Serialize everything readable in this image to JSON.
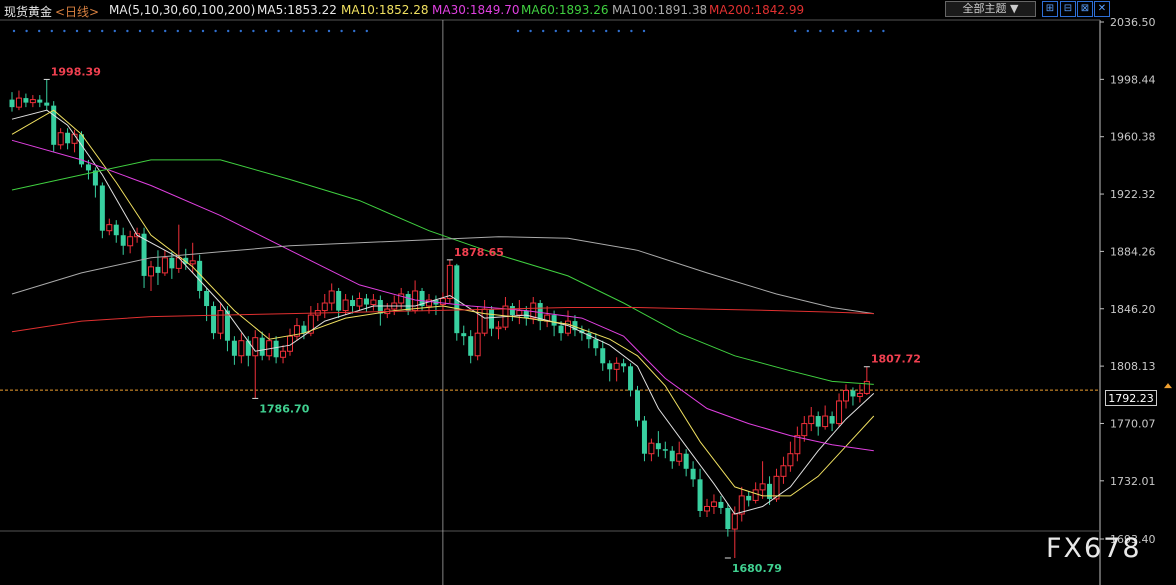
{
  "header": {
    "instrument": "现货黄金",
    "period": "<日线>",
    "ma_params": "MA(5,10,30,60,100,200)",
    "ma5": "MA5:1853.22",
    "ma10": "MA10:1852.28",
    "ma30": "MA30:1849.70",
    "ma60": "MA60:1893.26",
    "ma100": "MA100:1891.38",
    "ma200": "MA200:1842.99",
    "theme_label": "全部主题",
    "buttons": [
      "⊞",
      "⊟",
      "⊠",
      "✕"
    ]
  },
  "colors": {
    "up": "#f0303a",
    "down": "#38d0a0",
    "ma5": "#e0e0e0",
    "ma10": "#f0e060",
    "ma30": "#e040e0",
    "ma60": "#40d040",
    "ma100": "#aaaaaa",
    "ma200": "#e03030",
    "price_line": "#f0a030"
  },
  "watermark": "FX678",
  "current_price": "1792.23",
  "chart_data": {
    "type": "candlestick",
    "yticks": [
      2036.5,
      1998.44,
      1960.38,
      1922.32,
      1884.26,
      1846.2,
      1808.13,
      1770.07,
      1732.01,
      1693.4
    ],
    "ytick_labels": [
      "2036.50",
      "1998.44",
      "1960.38",
      "1922.32",
      "1884.26",
      "1846.20",
      "1808.13",
      "1770.07",
      "1732.01",
      "1693.40"
    ],
    "annotations": [
      {
        "text": "1998.39",
        "index": 5,
        "value": 1998.39,
        "type": "high"
      },
      {
        "text": "1786.70",
        "index": 35,
        "value": 1786.7,
        "type": "low"
      },
      {
        "text": "1878.65",
        "index": 63,
        "value": 1878.65,
        "type": "high"
      },
      {
        "text": "1680.79",
        "index": 103,
        "value": 1680.79,
        "type": "low"
      },
      {
        "text": "1807.72",
        "index": 123,
        "value": 1807.72,
        "type": "high"
      }
    ],
    "candles": [
      [
        1985,
        1980,
        1990,
        1977
      ],
      [
        1980,
        1986,
        1991,
        1978
      ],
      [
        1986,
        1983,
        1989,
        1980
      ],
      [
        1983,
        1985,
        1988,
        1980
      ],
      [
        1985,
        1983,
        1988,
        1980
      ],
      [
        1983,
        1981,
        1998.39,
        1978
      ],
      [
        1981,
        1955,
        1984,
        1950
      ],
      [
        1955,
        1963,
        1966,
        1952
      ],
      [
        1963,
        1956,
        1966,
        1952
      ],
      [
        1956,
        1962,
        1965,
        1950
      ],
      [
        1962,
        1942,
        1964,
        1940
      ],
      [
        1942,
        1938,
        1945,
        1932
      ],
      [
        1938,
        1928,
        1940,
        1920
      ],
      [
        1928,
        1898,
        1930,
        1893
      ],
      [
        1898,
        1902,
        1906,
        1895
      ],
      [
        1902,
        1895,
        1905,
        1890
      ],
      [
        1895,
        1888,
        1900,
        1882
      ],
      [
        1888,
        1894,
        1898,
        1883
      ],
      [
        1894,
        1896,
        1900,
        1890
      ],
      [
        1896,
        1868,
        1900,
        1860
      ],
      [
        1868,
        1874,
        1878,
        1858
      ],
      [
        1874,
        1870,
        1885,
        1862
      ],
      [
        1870,
        1880,
        1885,
        1868
      ],
      [
        1880,
        1873,
        1884,
        1866
      ],
      [
        1873,
        1880,
        1902,
        1870
      ],
      [
        1880,
        1876,
        1886,
        1872
      ],
      [
        1876,
        1878,
        1890,
        1870
      ],
      [
        1878,
        1858,
        1882,
        1853
      ],
      [
        1858,
        1848,
        1860,
        1838
      ],
      [
        1848,
        1830,
        1851,
        1826
      ],
      [
        1830,
        1845,
        1850,
        1826
      ],
      [
        1845,
        1825,
        1848,
        1818
      ],
      [
        1825,
        1815,
        1828,
        1809
      ],
      [
        1815,
        1825,
        1830,
        1810
      ],
      [
        1825,
        1815,
        1828,
        1808
      ],
      [
        1815,
        1827,
        1832,
        1786.7
      ],
      [
        1827,
        1815,
        1831,
        1812
      ],
      [
        1815,
        1825,
        1830,
        1812
      ],
      [
        1825,
        1814,
        1828,
        1810
      ],
      [
        1814,
        1818,
        1822,
        1810
      ],
      [
        1818,
        1828,
        1833,
        1815
      ],
      [
        1828,
        1835,
        1840,
        1825
      ],
      [
        1835,
        1830,
        1838,
        1826
      ],
      [
        1830,
        1842,
        1848,
        1828
      ],
      [
        1842,
        1845,
        1850,
        1838
      ],
      [
        1845,
        1850,
        1856,
        1840
      ],
      [
        1850,
        1858,
        1863,
        1845
      ],
      [
        1858,
        1845,
        1860,
        1840
      ],
      [
        1845,
        1852,
        1856,
        1842
      ],
      [
        1852,
        1848,
        1855,
        1843
      ],
      [
        1848,
        1853,
        1857,
        1845
      ],
      [
        1853,
        1849,
        1856,
        1844
      ],
      [
        1849,
        1852,
        1856,
        1845
      ],
      [
        1852,
        1843,
        1855,
        1835
      ],
      [
        1843,
        1846,
        1850,
        1840
      ],
      [
        1846,
        1850,
        1855,
        1842
      ],
      [
        1850,
        1856,
        1860,
        1846
      ],
      [
        1856,
        1845,
        1858,
        1842
      ],
      [
        1845,
        1858,
        1865,
        1843
      ],
      [
        1858,
        1848,
        1860,
        1845
      ],
      [
        1848,
        1852,
        1856,
        1843
      ],
      [
        1852,
        1849,
        1855,
        1842
      ],
      [
        1849,
        1853,
        1857,
        1845
      ],
      [
        1853,
        1875,
        1878.65,
        1850
      ],
      [
        1875,
        1830,
        1876,
        1825
      ],
      [
        1830,
        1828,
        1835,
        1822
      ],
      [
        1828,
        1815,
        1832,
        1810
      ],
      [
        1815,
        1830,
        1848,
        1812
      ],
      [
        1830,
        1846,
        1852,
        1828
      ],
      [
        1846,
        1833,
        1848,
        1828
      ],
      [
        1833,
        1834,
        1838,
        1826
      ],
      [
        1834,
        1848,
        1854,
        1832
      ],
      [
        1848,
        1842,
        1850,
        1838
      ],
      [
        1842,
        1845,
        1852,
        1836
      ],
      [
        1845,
        1840,
        1848,
        1835
      ],
      [
        1840,
        1850,
        1854,
        1836
      ],
      [
        1850,
        1838,
        1852,
        1832
      ],
      [
        1838,
        1842,
        1848,
        1834
      ],
      [
        1842,
        1835,
        1845,
        1828
      ],
      [
        1835,
        1830,
        1838,
        1825
      ],
      [
        1830,
        1838,
        1845,
        1828
      ],
      [
        1838,
        1832,
        1842,
        1828
      ],
      [
        1832,
        1830,
        1835,
        1825
      ],
      [
        1830,
        1826,
        1833,
        1820
      ],
      [
        1826,
        1820,
        1830,
        1815
      ],
      [
        1820,
        1810,
        1825,
        1805
      ],
      [
        1810,
        1806,
        1812,
        1798
      ],
      [
        1806,
        1810,
        1814,
        1798
      ],
      [
        1810,
        1808,
        1813,
        1804
      ],
      [
        1808,
        1792,
        1810,
        1788
      ],
      [
        1792,
        1772,
        1795,
        1768
      ],
      [
        1772,
        1750,
        1775,
        1745
      ],
      [
        1750,
        1757,
        1760,
        1745
      ],
      [
        1757,
        1753,
        1765,
        1748
      ],
      [
        1753,
        1752,
        1758,
        1747
      ],
      [
        1752,
        1745,
        1755,
        1740
      ],
      [
        1745,
        1750,
        1758,
        1742
      ],
      [
        1750,
        1740,
        1753,
        1735
      ],
      [
        1740,
        1733,
        1745,
        1728
      ],
      [
        1733,
        1712,
        1740,
        1708
      ],
      [
        1712,
        1715,
        1720,
        1708
      ],
      [
        1715,
        1718,
        1723,
        1710
      ],
      [
        1718,
        1714,
        1722,
        1710
      ],
      [
        1714,
        1700,
        1717,
        1695
      ],
      [
        1700,
        1710,
        1715,
        1680.79
      ],
      [
        1710,
        1722,
        1728,
        1705
      ],
      [
        1722,
        1719,
        1725,
        1715
      ],
      [
        1719,
        1726,
        1731,
        1717
      ],
      [
        1726,
        1730,
        1745,
        1720
      ],
      [
        1730,
        1720,
        1735,
        1716
      ],
      [
        1720,
        1735,
        1740,
        1718
      ],
      [
        1735,
        1742,
        1748,
        1730
      ],
      [
        1742,
        1750,
        1758,
        1738
      ],
      [
        1750,
        1762,
        1768,
        1745
      ],
      [
        1762,
        1770,
        1775,
        1758
      ],
      [
        1770,
        1775,
        1781,
        1765
      ],
      [
        1775,
        1768,
        1778,
        1762
      ],
      [
        1768,
        1775,
        1782,
        1766
      ],
      [
        1775,
        1770,
        1778,
        1765
      ],
      [
        1770,
        1785,
        1790,
        1768
      ],
      [
        1785,
        1792,
        1796,
        1780
      ],
      [
        1792,
        1788,
        1794,
        1782
      ],
      [
        1788,
        1790,
        1796,
        1784
      ],
      [
        1790,
        1798,
        1807.72,
        1789
      ]
    ],
    "ma": [
      {
        "name": "MA5",
        "color_key": "ma5",
        "points": [
          [
            0,
            1972
          ],
          [
            5,
            1978
          ],
          [
            8,
            1968
          ],
          [
            13,
            1935
          ],
          [
            18,
            1895
          ],
          [
            24,
            1880
          ],
          [
            30,
            1850
          ],
          [
            35,
            1818
          ],
          [
            40,
            1822
          ],
          [
            45,
            1838
          ],
          [
            52,
            1848
          ],
          [
            58,
            1848
          ],
          [
            63,
            1855
          ],
          [
            68,
            1840
          ],
          [
            74,
            1842
          ],
          [
            80,
            1835
          ],
          [
            86,
            1822
          ],
          [
            90,
            1808
          ],
          [
            93,
            1780
          ],
          [
            97,
            1755
          ],
          [
            101,
            1730
          ],
          [
            104,
            1710
          ],
          [
            108,
            1715
          ],
          [
            112,
            1728
          ],
          [
            116,
            1752
          ],
          [
            120,
            1773
          ],
          [
            124,
            1790
          ]
        ]
      },
      {
        "name": "MA10",
        "color_key": "ma10",
        "points": [
          [
            0,
            1962
          ],
          [
            6,
            1978
          ],
          [
            10,
            1962
          ],
          [
            15,
            1930
          ],
          [
            20,
            1895
          ],
          [
            26,
            1874
          ],
          [
            32,
            1845
          ],
          [
            37,
            1826
          ],
          [
            42,
            1830
          ],
          [
            48,
            1840
          ],
          [
            55,
            1845
          ],
          [
            62,
            1848
          ],
          [
            68,
            1843
          ],
          [
            74,
            1840
          ],
          [
            80,
            1836
          ],
          [
            86,
            1826
          ],
          [
            90,
            1815
          ],
          [
            94,
            1795
          ],
          [
            99,
            1758
          ],
          [
            104,
            1728
          ],
          [
            108,
            1722
          ],
          [
            112,
            1722
          ],
          [
            116,
            1735
          ],
          [
            120,
            1755
          ],
          [
            124,
            1775
          ]
        ]
      },
      {
        "name": "MA30",
        "color_key": "ma30",
        "points": [
          [
            0,
            1958
          ],
          [
            10,
            1945
          ],
          [
            20,
            1928
          ],
          [
            30,
            1908
          ],
          [
            40,
            1885
          ],
          [
            50,
            1862
          ],
          [
            58,
            1852
          ],
          [
            66,
            1848
          ],
          [
            74,
            1845
          ],
          [
            82,
            1840
          ],
          [
            88,
            1828
          ],
          [
            94,
            1800
          ],
          [
            100,
            1780
          ],
          [
            106,
            1770
          ],
          [
            112,
            1762
          ],
          [
            118,
            1756
          ],
          [
            124,
            1752
          ]
        ]
      },
      {
        "name": "MA60",
        "color_key": "ma60",
        "points": [
          [
            0,
            1925
          ],
          [
            10,
            1935
          ],
          [
            20,
            1945
          ],
          [
            30,
            1945
          ],
          [
            40,
            1932
          ],
          [
            50,
            1918
          ],
          [
            60,
            1898
          ],
          [
            70,
            1882
          ],
          [
            80,
            1868
          ],
          [
            88,
            1850
          ],
          [
            96,
            1830
          ],
          [
            104,
            1815
          ],
          [
            112,
            1805
          ],
          [
            118,
            1798
          ],
          [
            124,
            1796
          ]
        ]
      },
      {
        "name": "MA100",
        "color_key": "ma100",
        "points": [
          [
            0,
            1856
          ],
          [
            10,
            1870
          ],
          [
            20,
            1880
          ],
          [
            30,
            1884
          ],
          [
            40,
            1888
          ],
          [
            50,
            1890
          ],
          [
            60,
            1892
          ],
          [
            70,
            1894
          ],
          [
            80,
            1893
          ],
          [
            90,
            1885
          ],
          [
            100,
            1870
          ],
          [
            110,
            1856
          ],
          [
            118,
            1847
          ],
          [
            124,
            1843
          ]
        ]
      },
      {
        "name": "MA200",
        "color_key": "ma200",
        "points": [
          [
            0,
            1831
          ],
          [
            10,
            1838
          ],
          [
            20,
            1841
          ],
          [
            30,
            1842
          ],
          [
            40,
            1843
          ],
          [
            50,
            1844
          ],
          [
            60,
            1845
          ],
          [
            70,
            1846
          ],
          [
            80,
            1847
          ],
          [
            90,
            1847
          ],
          [
            100,
            1846
          ],
          [
            110,
            1845
          ],
          [
            118,
            1844
          ],
          [
            124,
            1843
          ]
        ]
      }
    ],
    "price_line": 1792.23,
    "cursor_index": 62
  }
}
